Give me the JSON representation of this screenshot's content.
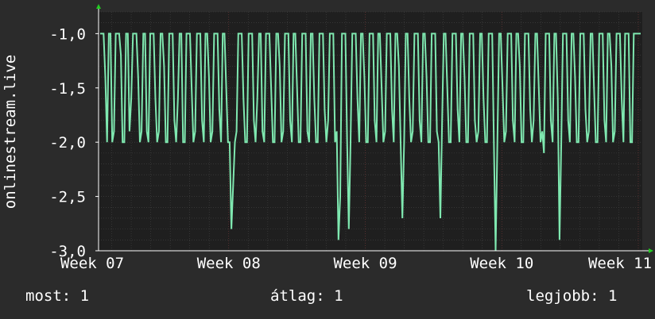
{
  "chart_data": {
    "type": "line",
    "ylabel": "onlinestream.live",
    "ylim": [
      -3.0,
      -0.8
    ],
    "yticks": [
      -1.0,
      -1.5,
      -2.0,
      -2.5,
      -3.0
    ],
    "ytick_labels": [
      "-1,0",
      "-1,5",
      "-2,0",
      "-2,5",
      "-3,0"
    ],
    "xtick_labels": [
      "Week 07",
      "Week 08",
      "Week 09",
      "Week 10",
      "Week 11"
    ],
    "grid": true,
    "series": [
      {
        "values": [
          -1,
          -1,
          -1,
          -1.4,
          -2,
          -1,
          -1,
          -2,
          -1.9,
          -1,
          -1,
          -1,
          -1.2,
          -2,
          -2,
          -1,
          -1,
          -1.9,
          -1.6,
          -1,
          -1,
          -1,
          -1.4,
          -2,
          -1.9,
          -1,
          -1,
          -1.9,
          -2,
          -1,
          -1,
          -1,
          -1.6,
          -2,
          -1.9,
          -1,
          -1,
          -1.3,
          -2,
          -2,
          -1,
          -1,
          -1,
          -1.8,
          -2,
          -1.6,
          -1,
          -1,
          -2,
          -2,
          -1,
          -1,
          -1,
          -1.5,
          -2,
          -1.9,
          -1,
          -1,
          -1,
          -1.8,
          -2,
          -1,
          -1,
          -1.4,
          -2,
          -1.9,
          -1,
          -1,
          -1,
          -1.7,
          -2,
          -1,
          -1,
          -1.5,
          -2,
          -2,
          -2.8,
          -2.4,
          -2,
          -1.9,
          -1,
          -1,
          -1,
          -1.6,
          -2,
          -2,
          -1,
          -1,
          -1,
          -1.8,
          -2,
          -1.6,
          -1,
          -1,
          -1.9,
          -2,
          -1,
          -1,
          -1,
          -1.5,
          -2,
          -2,
          -1,
          -1,
          -1.3,
          -2,
          -1.9,
          -1,
          -1,
          -1,
          -1.8,
          -2,
          -1,
          -1,
          -1.5,
          -2,
          -2,
          -1,
          -1,
          -1,
          -1.9,
          -2,
          -1,
          -1,
          -1.6,
          -2,
          -2,
          -1,
          -1,
          -1,
          -1.7,
          -2,
          -1.8,
          -1,
          -1,
          -1,
          -2,
          -1.9,
          -2.9,
          -2.5,
          -1,
          -1,
          -1,
          -2,
          -2.8,
          -2,
          -1,
          -1,
          -1,
          -1.6,
          -2,
          -1,
          -1,
          -1.4,
          -2,
          -2,
          -1,
          -1,
          -1,
          -1.8,
          -2,
          -1,
          -1,
          -1.5,
          -2,
          -1.9,
          -1,
          -1,
          -1,
          -1.7,
          -2,
          -1,
          -1,
          -1.3,
          -2,
          -2.7,
          -2,
          -1,
          -1,
          -1.6,
          -2,
          -1.9,
          -1,
          -1,
          -1,
          -1.8,
          -2,
          -1,
          -1,
          -1.4,
          -2,
          -2,
          -1,
          -1,
          -1,
          -1.9,
          -2,
          -2.7,
          -1.8,
          -1,
          -1,
          -1.5,
          -2,
          -2,
          -1,
          -1,
          -1,
          -1.7,
          -2,
          -1,
          -1,
          -1.4,
          -2,
          -2,
          -1,
          -1,
          -1,
          -1.8,
          -2,
          -1.9,
          -1,
          -1,
          -1.6,
          -2,
          -2,
          -1,
          -1,
          -1,
          -2,
          -3,
          -2,
          -1,
          -1,
          -1.5,
          -2,
          -1.9,
          -1,
          -1,
          -1,
          -1.8,
          -2,
          -1,
          -1,
          -1.3,
          -2,
          -2,
          -1,
          -1,
          -1,
          -1.7,
          -2,
          -1.8,
          -1,
          -1,
          -1.5,
          -2,
          -1.9,
          -2.1,
          -1,
          -1,
          -1,
          -1.8,
          -2,
          -1,
          -1,
          -1.6,
          -2.9,
          -2,
          -1,
          -1,
          -1,
          -1.8,
          -2,
          -1,
          -1,
          -1.4,
          -2,
          -2,
          -1,
          -1,
          -1,
          -1.7,
          -2,
          -1.9,
          -1,
          -1,
          -1.5,
          -2,
          -2,
          -1,
          -1,
          -1,
          -1.8,
          -2,
          -1,
          -1,
          -1.3,
          -2,
          -1.9,
          -1,
          -1,
          -1,
          -1.6,
          -2,
          -1,
          -1,
          -1,
          -2,
          -2,
          -1,
          -1,
          -1,
          -1,
          -1
        ]
      }
    ],
    "colors": {
      "line": "#7fe8b0",
      "plot_bg": "#1f1f1f",
      "page_bg": "#2b2b2b",
      "grid": "#444444",
      "grid_dotted": "#7a3a3a",
      "arrow": "#22cc22"
    }
  },
  "footer": {
    "now": "most: 1",
    "avg": "átlag: 1",
    "best": "legjobb: 1"
  }
}
